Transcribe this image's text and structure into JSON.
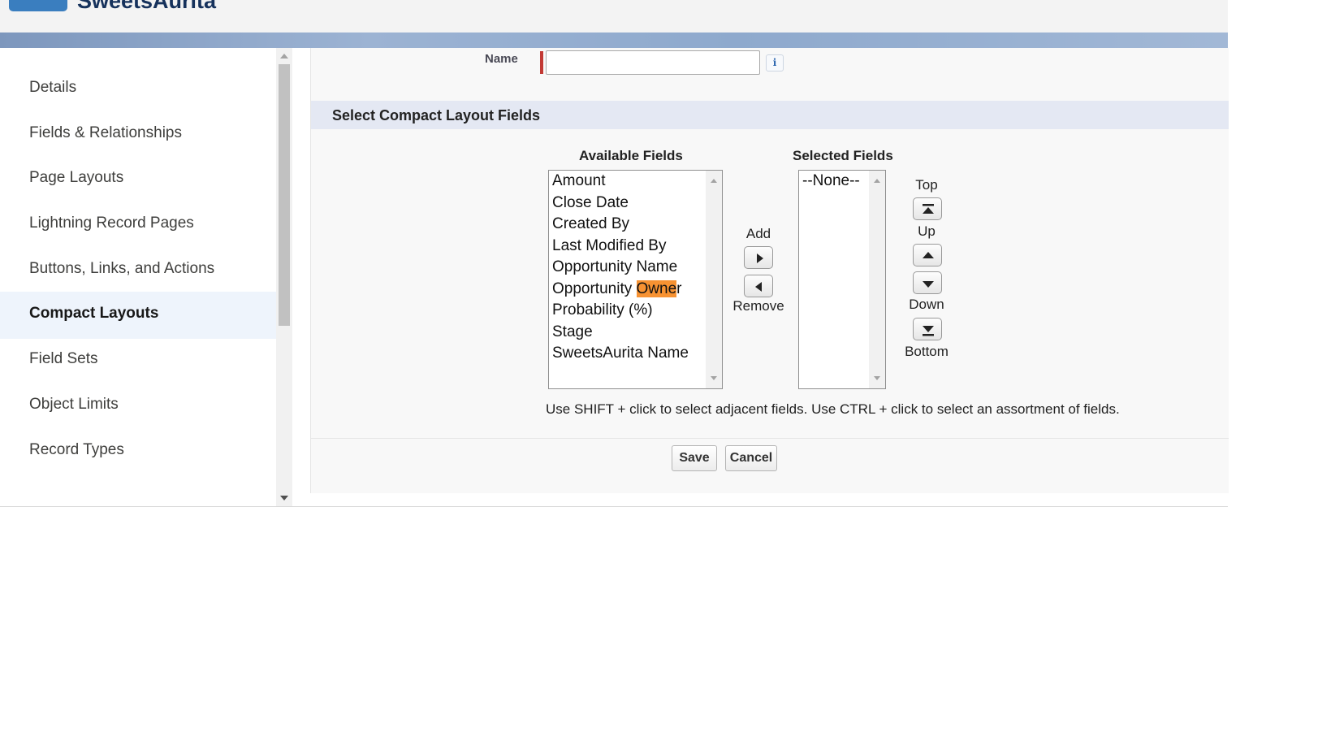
{
  "header": {
    "app_title": "SweetsAurita"
  },
  "sidebar": {
    "items": [
      {
        "label": "Details",
        "active": false
      },
      {
        "label": "Fields & Relationships",
        "active": false
      },
      {
        "label": "Page Layouts",
        "active": false
      },
      {
        "label": "Lightning Record Pages",
        "active": false
      },
      {
        "label": "Buttons, Links, and Actions",
        "active": false
      },
      {
        "label": "Compact Layouts",
        "active": true
      },
      {
        "label": "Field Sets",
        "active": false
      },
      {
        "label": "Object Limits",
        "active": false
      },
      {
        "label": "Record Types",
        "active": false
      }
    ]
  },
  "form": {
    "name_label": "Name",
    "name_value": "",
    "info_icon": "i",
    "section_title": "Select Compact Layout Fields",
    "available_label": "Available Fields",
    "selected_label": "Selected Fields",
    "available_fields": [
      "Amount",
      "Close Date",
      "Created By",
      "Last Modified By",
      "Opportunity Name",
      "Opportunity Owner",
      "Probability (%)",
      "Stage",
      "SweetsAurita Name"
    ],
    "available_highlight": {
      "option": "Opportunity Owner",
      "text": "Owne"
    },
    "selected_fields": [
      "--None--"
    ],
    "add_label": "Add",
    "remove_label": "Remove",
    "top_label": "Top",
    "up_label": "Up",
    "down_label": "Down",
    "bottom_label": "Bottom",
    "hint": "Use SHIFT + click to select adjacent fields. Use CTRL + click to select an assortment of fields.",
    "save_label": "Save",
    "cancel_label": "Cancel"
  },
  "colors": {
    "highlight": "#f79232",
    "required": "#c23934",
    "section_bg": "#e4e8f3",
    "active_nav_bg": "#eef4fc"
  }
}
